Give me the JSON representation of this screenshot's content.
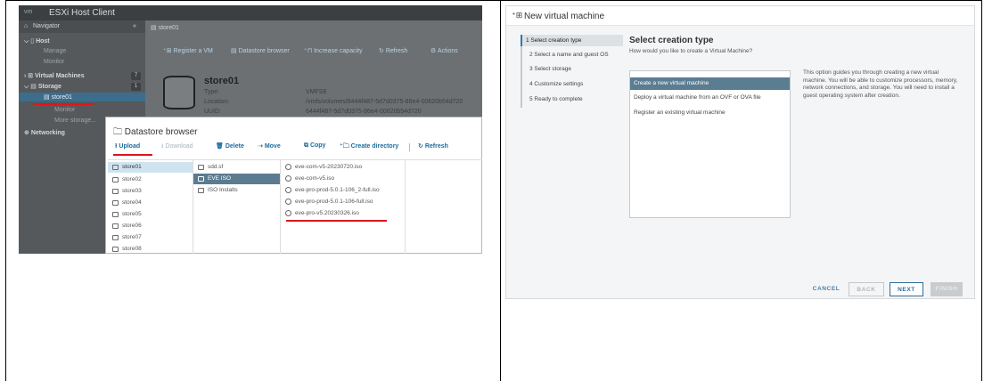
{
  "esxi": {
    "logo": "vm",
    "title": "ESXi Host Client",
    "nav_header": "Navigator",
    "nav_collapse": "«",
    "nav": {
      "host": "Host",
      "manage": "Manage",
      "monitor": "Monitor",
      "vms": "Virtual Machines",
      "vms_count": "7",
      "storage": "Storage",
      "storage_count": "1",
      "store": "store01",
      "store_monitor": "Monitor",
      "more_storage": "More storage...",
      "networking": "Networking"
    },
    "breadcrumb": "store01",
    "toolbar": {
      "register": "Register a VM",
      "browser": "Datastore browser",
      "increase": "Increase capacity",
      "refresh": "Refresh",
      "actions": "Actions"
    },
    "store_title": "store01",
    "props": {
      "type_label": "Type:",
      "type_value": "VMFS6",
      "location_label": "Location:",
      "location_value": "/vmfs/volumes/6444f487-5d7d0375-86e4-00620b54d720",
      "uuid_label": "UUID:",
      "uuid_value": "6444f487-5d7d0375-86e4-00620b54d720"
    },
    "datastore_browser": {
      "title": "Datastore browser",
      "tools": {
        "upload": "Upload",
        "download": "Download",
        "delete": "Delete",
        "move": "Move",
        "copy": "Copy",
        "create_dir": "Create directory",
        "refresh": "Refresh"
      },
      "datastores": [
        "store01",
        "store02",
        "store03",
        "store04",
        "store05",
        "store06",
        "store07",
        "store08"
      ],
      "folders": [
        "sdd.sf",
        "EVE ISO",
        "ISO Instalts"
      ],
      "files": [
        "eve-com-v5-20230720.iso",
        "eve-com-v5.iso",
        "eve-pro-prod-5.0.1-106_2-full.iso",
        "eve-pro-prod-5.0.1-106-full.iso",
        "eve-pro-v5.20230326.iso"
      ]
    }
  },
  "wizard": {
    "icon": "⁺⊞",
    "title": "New virtual machine",
    "steps": [
      "1  Select creation type",
      "2  Select a name and guest OS",
      "3  Select storage",
      "4  Customize settings",
      "5  Ready to complete"
    ],
    "section_title": "Select creation type",
    "section_subtitle": "How would you like to create a Virtual Machine?",
    "options": [
      "Create a new virtual machine",
      "Deploy a virtual machine from an OVF or OVA file",
      "Register an existing virtual machine"
    ],
    "description": "This option guides you through creating a new virtual machine. You will be able to customize processors, memory, network connections, and storage. You will need to install a guest operating system after creation.",
    "buttons": {
      "cancel": "CANCEL",
      "back": "BACK",
      "next": "NEXT",
      "finish": "FINISH"
    }
  },
  "colors": {
    "accent": "#2f6f9b",
    "underline": "#e0141e",
    "selection": "#5a7d92"
  }
}
